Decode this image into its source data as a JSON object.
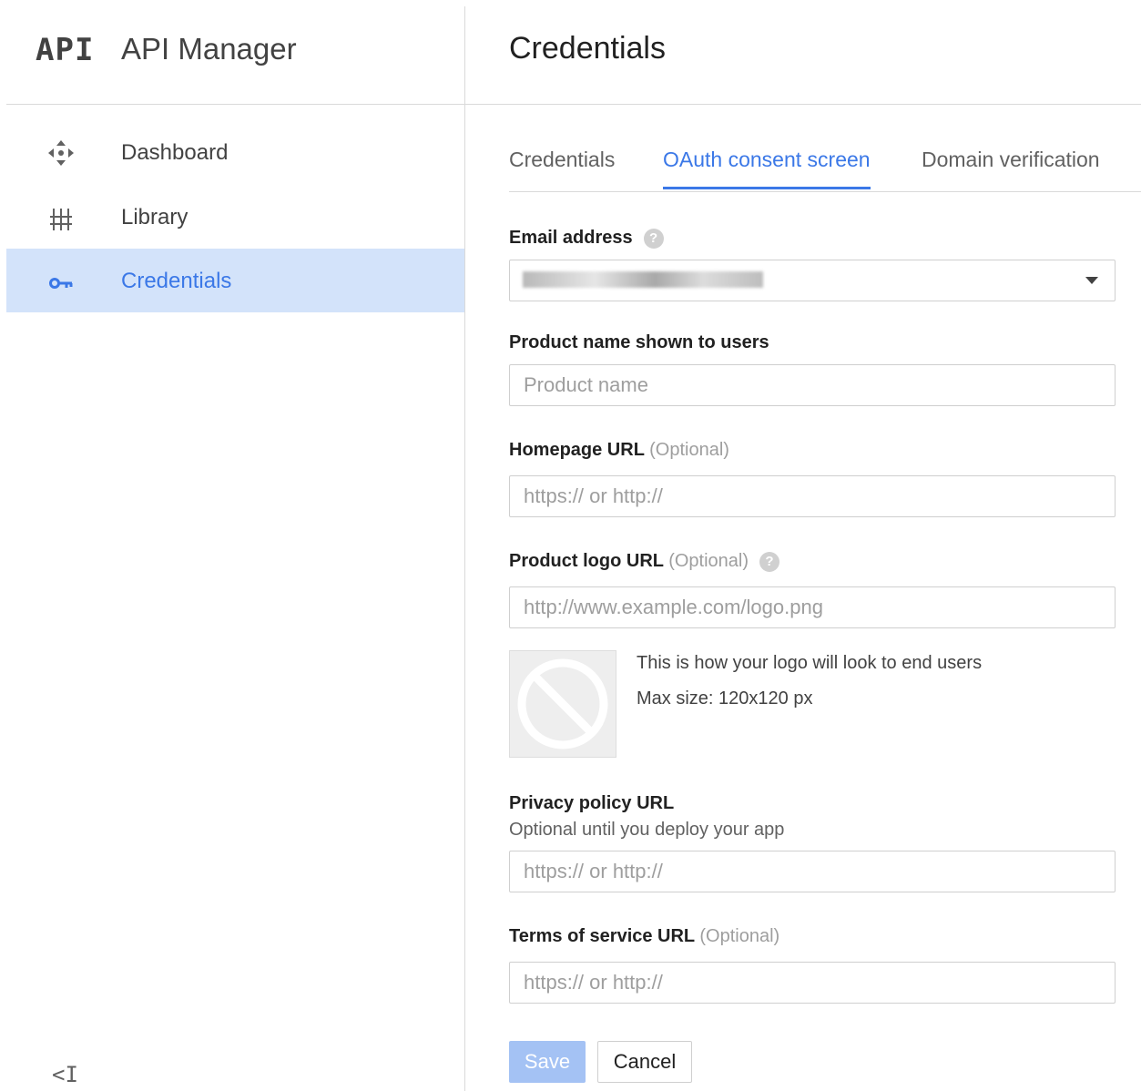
{
  "sidebar": {
    "logo": "API",
    "title": "API Manager",
    "items": [
      {
        "label": "Dashboard",
        "icon": "dashboard-icon",
        "active": false
      },
      {
        "label": "Library",
        "icon": "library-icon",
        "active": false
      },
      {
        "label": "Credentials",
        "icon": "key-icon",
        "active": true
      }
    ],
    "collapse_label": "<I"
  },
  "main": {
    "title": "Credentials",
    "tabs": [
      {
        "label": "Credentials",
        "active": false
      },
      {
        "label": "OAuth consent screen",
        "active": true
      },
      {
        "label": "Domain verification",
        "active": false
      }
    ]
  },
  "form": {
    "email": {
      "label": "Email address"
    },
    "product_name": {
      "label": "Product name shown to users",
      "placeholder": "Product name"
    },
    "homepage": {
      "label": "Homepage URL",
      "optional": "(Optional)",
      "placeholder": "https:// or http://"
    },
    "logo_url": {
      "label": "Product logo URL",
      "optional": "(Optional)",
      "placeholder": "http://www.example.com/logo.png",
      "preview_text": "This is how your logo will look to end users",
      "max_size": "Max size: 120x120 px"
    },
    "privacy": {
      "label": "Privacy policy URL",
      "sublabel": "Optional until you deploy your app",
      "placeholder": "https:// or http://"
    },
    "terms": {
      "label": "Terms of service URL",
      "optional": "(Optional)",
      "placeholder": "https:// or http://"
    },
    "save_label": "Save",
    "cancel_label": "Cancel"
  },
  "colors": {
    "accent": "#3b78e7",
    "active_bg": "#d3e3fa",
    "save_disabled": "#a4c2f4"
  }
}
